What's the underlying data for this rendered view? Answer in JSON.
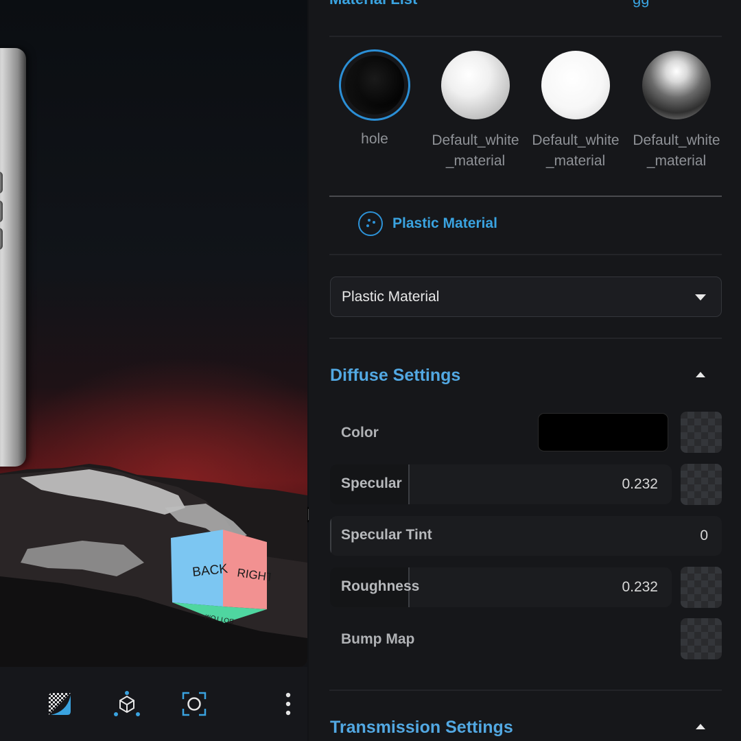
{
  "panel": {
    "header_title": "Material List",
    "header_extra": "gg"
  },
  "materials": [
    {
      "label": "hole",
      "selected": true
    },
    {
      "label": "Default_white_material",
      "selected": false
    },
    {
      "label": "Default_white_material",
      "selected": false
    },
    {
      "label": "Default_white_material",
      "selected": false
    }
  ],
  "material_type": {
    "label": "Plastic Material",
    "icon": "palette-icon"
  },
  "material_select": {
    "value": "Plastic Material"
  },
  "diffuse": {
    "title": "Diffuse Settings",
    "color_label": "Color",
    "color_value": "#000000",
    "specular": {
      "label": "Specular",
      "value": "0.232",
      "fraction": 0.232
    },
    "specular_tint": {
      "label": "Specular Tint",
      "value": "0",
      "fraction": 0
    },
    "roughness": {
      "label": "Roughness",
      "value": "0.232",
      "fraction": 0.232
    },
    "bump_label": "Bump Map"
  },
  "transmission": {
    "title": "Transmission Settings"
  },
  "view_cube": {
    "back": "BACK",
    "right": "RIGHT",
    "bottom": "BOTTOM"
  },
  "toolbar": {
    "icons": [
      "environment-icon",
      "scene-graph-icon",
      "focus-icon",
      "more-vertical-icon"
    ]
  },
  "colors": {
    "accent": "#3aa3e0",
    "selected_ring": "#2b8fd6",
    "panel_bg": "#16171a"
  }
}
